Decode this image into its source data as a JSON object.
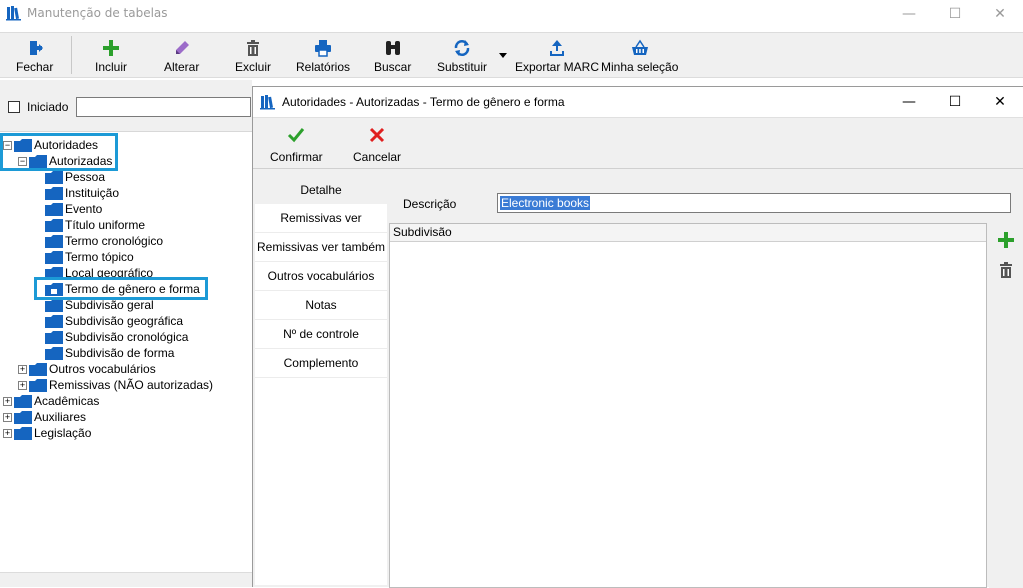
{
  "main_window": {
    "title": "Manutenção de tabelas",
    "controls": {
      "minimize": "—",
      "maximize": "☐",
      "close": "✕"
    }
  },
  "toolbar": {
    "fechar": "Fechar",
    "incluir": "Incluir",
    "alterar": "Alterar",
    "excluir": "Excluir",
    "relatorios": "Relatórios",
    "buscar": "Buscar",
    "substituir": "Substituir",
    "exportar_marc": "Exportar MARC",
    "minha_selecao": "Minha seleção"
  },
  "filter": {
    "checkbox_label": "Iniciado",
    "checked": false,
    "input_value": ""
  },
  "tree": {
    "items": [
      {
        "label": "Autoridades",
        "expander": "−"
      },
      {
        "label": "Autorizadas",
        "expander": "−"
      },
      {
        "label": "Pessoa"
      },
      {
        "label": "Instituição"
      },
      {
        "label": "Evento"
      },
      {
        "label": "Título uniforme"
      },
      {
        "label": "Termo cronológico"
      },
      {
        "label": "Termo tópico"
      },
      {
        "label": "Local geográfico"
      },
      {
        "label": "Termo de gênero e forma",
        "selected": true
      },
      {
        "label": "Subdivisão geral"
      },
      {
        "label": "Subdivisão geográfica"
      },
      {
        "label": "Subdivisão cronológica"
      },
      {
        "label": "Subdivisão de forma"
      },
      {
        "label": "Outros vocabulários",
        "expander": "+"
      },
      {
        "label": "Remissivas (NÃO autorizadas)",
        "expander": "+"
      },
      {
        "label": "Acadêmicas",
        "expander": "+"
      },
      {
        "label": "Auxiliares",
        "expander": "+"
      },
      {
        "label": "Legislação",
        "expander": "+"
      }
    ]
  },
  "dialog": {
    "title": "Autoridades - Autorizadas - Termo de gênero e forma",
    "controls": {
      "minimize": "—",
      "maximize": "☐",
      "close": "✕"
    },
    "confirmar": "Confirmar",
    "cancelar": "Cancelar",
    "tabs": [
      "Detalhe",
      "Remissivas ver",
      "Remissivas ver também",
      "Outros vocabulários",
      "Notas",
      "Nº de controle",
      "Complemento"
    ],
    "active_tab": "Detalhe",
    "descricao_label": "Descrição",
    "descricao_value": "Electronic books",
    "grid_header": "Subdivisão"
  },
  "colors": {
    "highlight": "#1c9ad6",
    "folder": "#1565c0",
    "add": "#2ca02c",
    "cancel": "#e02020"
  },
  "icons": [
    "books-icon",
    "exit-icon",
    "plus-icon",
    "pencil-icon",
    "trash-icon",
    "printer-icon",
    "binoculars-icon",
    "refresh-icon",
    "upload-icon",
    "basket-icon",
    "checkmark-icon",
    "x-icon",
    "folder-icon"
  ]
}
